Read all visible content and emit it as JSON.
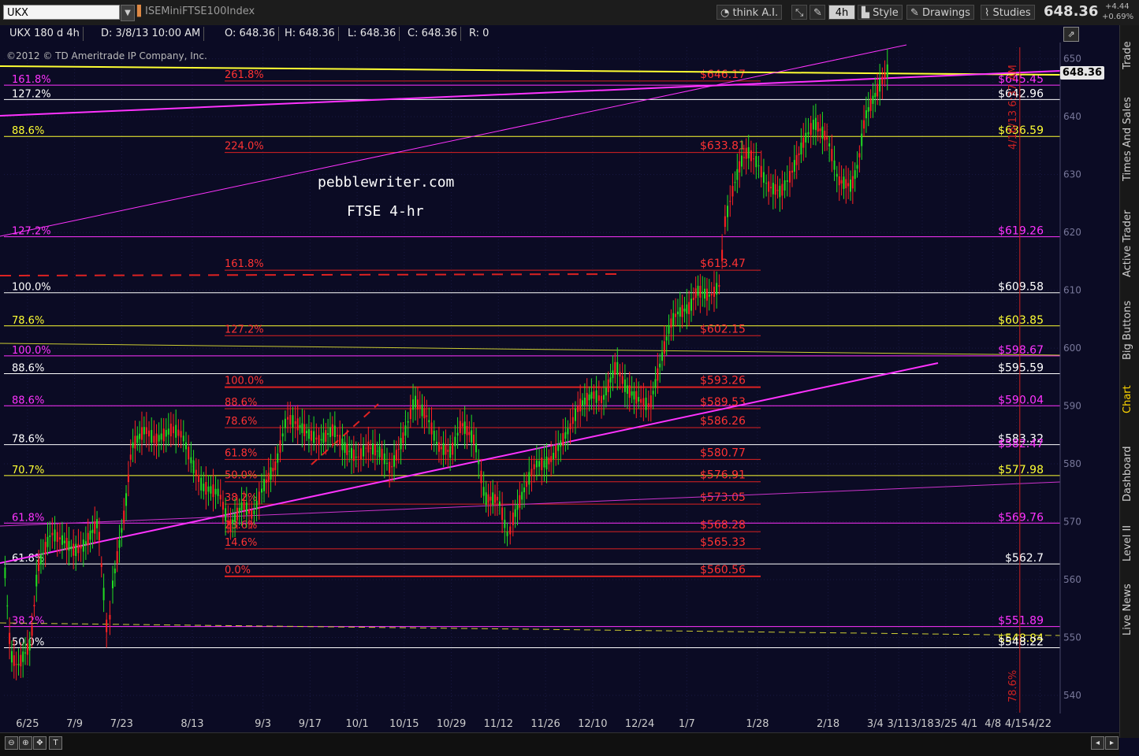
{
  "toolbar": {
    "symbol": "UKX",
    "symbol_description": "ISEMiniFTSE100Index",
    "think_label": "think A.I.",
    "timeframe": "4h",
    "style_label": "Style",
    "drawings_label": "Drawings",
    "studies_label": "Studies",
    "last_price": "648.36",
    "change_abs": "+4.44",
    "change_pct": "+0.69%"
  },
  "infobar": {
    "study": "UKX 180 d 4h",
    "date": "D: 3/8/13 10:00 AM",
    "open": "O: 648.36",
    "high": "H: 648.36",
    "low": "L: 648.36",
    "close": "C: 648.36",
    "range": "R: 0"
  },
  "copyright": "©2012 © TD Ameritrade IP Company, Inc.",
  "side_tabs": [
    "Trade",
    "Times And Sales",
    "Active Trader",
    "Big Buttons",
    "Chart",
    "Dashboard",
    "Level II",
    "Live News"
  ],
  "price_tag": "648.36",
  "colors": {
    "background": "#0b0b24",
    "magenta": "#ff33ff",
    "yellow": "#ffff33",
    "white": "#ffffff",
    "red": "#ff2222",
    "candle_up": "#22dd22",
    "candle_down": "#ff2222"
  },
  "chart_data": {
    "type": "line",
    "title": "FTSE 4-hr",
    "watermark": "pebblewriter.com",
    "x_ticks": [
      "6/25",
      "7/9",
      "7/23",
      "8/13",
      "9/3",
      "9/17",
      "10/1",
      "10/15",
      "10/29",
      "11/12",
      "11/26",
      "12/10",
      "12/24",
      "1/7",
      "1/28",
      "2/18",
      "3/4",
      "3/11",
      "3/18",
      "3/25",
      "4/1",
      "4/8",
      "4/15",
      "4/22"
    ],
    "y_ticks": [
      540,
      550,
      560,
      570,
      580,
      590,
      600,
      610,
      620,
      630,
      640,
      650
    ],
    "ylim": [
      537,
      652
    ],
    "x_range": [
      "2012-06-18",
      "2013-04-28"
    ],
    "series": [
      {
        "values": [
          [
            "2012-06-18",
            564
          ],
          [
            "2012-06-20",
            547
          ],
          [
            "2012-06-22",
            545
          ],
          [
            "2012-06-26",
            549
          ],
          [
            "2012-06-28",
            562
          ],
          [
            "2012-07-02",
            568
          ],
          [
            "2012-07-05",
            567
          ],
          [
            "2012-07-09",
            565
          ],
          [
            "2012-07-12",
            566
          ],
          [
            "2012-07-16",
            570
          ],
          [
            "2012-07-18",
            555
          ],
          [
            "2012-07-19",
            549
          ],
          [
            "2012-07-20",
            558
          ],
          [
            "2012-07-24",
            572
          ],
          [
            "2012-07-26",
            583
          ],
          [
            "2012-07-30",
            586
          ],
          [
            "2012-08-02",
            584
          ],
          [
            "2012-08-07",
            586
          ],
          [
            "2012-08-10",
            585
          ],
          [
            "2012-08-13",
            580
          ],
          [
            "2012-08-16",
            576
          ],
          [
            "2012-08-21",
            575
          ],
          [
            "2012-08-24",
            569
          ],
          [
            "2012-08-28",
            573
          ],
          [
            "2012-08-31",
            571
          ],
          [
            "2012-09-03",
            576
          ],
          [
            "2012-09-07",
            580
          ],
          [
            "2012-09-10",
            588
          ],
          [
            "2012-09-13",
            587
          ],
          [
            "2012-09-17",
            585
          ],
          [
            "2012-09-20",
            584
          ],
          [
            "2012-09-24",
            586
          ],
          [
            "2012-09-27",
            583
          ],
          [
            "2012-10-01",
            581
          ],
          [
            "2012-10-04",
            583
          ],
          [
            "2012-10-08",
            582
          ],
          [
            "2012-10-11",
            579
          ],
          [
            "2012-10-15",
            585
          ],
          [
            "2012-10-18",
            591
          ],
          [
            "2012-10-22",
            588
          ],
          [
            "2012-10-25",
            583
          ],
          [
            "2012-10-29",
            582
          ],
          [
            "2012-11-01",
            587
          ],
          [
            "2012-11-05",
            584
          ],
          [
            "2012-11-08",
            574
          ],
          [
            "2012-11-12",
            574
          ],
          [
            "2012-11-15",
            567
          ],
          [
            "2012-11-16",
            570
          ],
          [
            "2012-11-20",
            576
          ],
          [
            "2012-11-23",
            580
          ],
          [
            "2012-11-26",
            580
          ],
          [
            "2012-11-28",
            581
          ],
          [
            "2012-12-03",
            586
          ],
          [
            "2012-12-06",
            590
          ],
          [
            "2012-12-10",
            592
          ],
          [
            "2012-12-13",
            591
          ],
          [
            "2012-12-17",
            597
          ],
          [
            "2012-12-20",
            593
          ],
          [
            "2012-12-24",
            591
          ],
          [
            "2012-12-27",
            590
          ],
          [
            "2013-01-02",
            604
          ],
          [
            "2013-01-04",
            606
          ],
          [
            "2013-01-08",
            607
          ],
          [
            "2013-01-10",
            610
          ],
          [
            "2013-01-14",
            609
          ],
          [
            "2013-01-17",
            611
          ],
          [
            "2013-01-18",
            621
          ],
          [
            "2013-01-21",
            628
          ],
          [
            "2013-01-23",
            632
          ],
          [
            "2013-01-25",
            634
          ],
          [
            "2013-01-28",
            632
          ],
          [
            "2013-01-31",
            628
          ],
          [
            "2013-02-04",
            627
          ],
          [
            "2013-02-07",
            630
          ],
          [
            "2013-02-11",
            636
          ],
          [
            "2013-02-14",
            639
          ],
          [
            "2013-02-18",
            636
          ],
          [
            "2013-02-21",
            629
          ],
          [
            "2013-02-25",
            628
          ],
          [
            "2013-02-27",
            632
          ],
          [
            "2013-03-01",
            640
          ],
          [
            "2013-03-05",
            645
          ],
          [
            "2013-03-08",
            648.36
          ]
        ]
      }
    ],
    "levels_left": [
      {
        "label": "161.8%",
        "price": 645.45,
        "color": "#ff33ff"
      },
      {
        "label": "127.2%",
        "price": 642.96,
        "color": "#ffffff"
      },
      {
        "label": "88.6%",
        "price": 636.59,
        "color": "#ffff33"
      },
      {
        "label": "127.2%",
        "price": 619.26,
        "color": "#ff33ff"
      },
      {
        "label": "100.0%",
        "price": 609.58,
        "color": "#ffffff"
      },
      {
        "label": "78.6%",
        "price": 603.85,
        "color": "#ffff33"
      },
      {
        "label": "100.0%",
        "price": 598.67,
        "color": "#ff33ff"
      },
      {
        "label": "88.6%",
        "price": 595.59,
        "color": "#ffffff"
      },
      {
        "label": "88.6%",
        "price": 590.04,
        "color": "#ff33ff"
      },
      {
        "label": "78.6%",
        "price": 583.32,
        "color": "#ffffff"
      },
      {
        "label": "70.7%",
        "price": 577.98,
        "color": "#ffff33"
      },
      {
        "label": "61.8%",
        "price": 569.76,
        "color": "#ff33ff"
      },
      {
        "label": "61.8%",
        "price": 562.7,
        "color": "#ffffff"
      },
      {
        "label": "38.2%",
        "price": 551.89,
        "color": "#ff33ff"
      },
      {
        "label": "50.0%",
        "price": 548.22,
        "color": "#ffffff"
      }
    ],
    "levels_right": [
      {
        "label": "$645.45",
        "price": 645.45,
        "color": "#ff33ff"
      },
      {
        "label": "$642.96",
        "price": 642.96,
        "color": "#ffffff"
      },
      {
        "label": "$636.59",
        "price": 636.59,
        "color": "#ffff33"
      },
      {
        "label": "$619.26",
        "price": 619.26,
        "color": "#ff33ff"
      },
      {
        "label": "$609.58",
        "price": 609.58,
        "color": "#ffffff"
      },
      {
        "label": "$603.85",
        "price": 603.85,
        "color": "#ffff33"
      },
      {
        "label": "$598.67",
        "price": 598.67,
        "color": "#ff33ff"
      },
      {
        "label": "$595.59",
        "price": 595.59,
        "color": "#ffffff"
      },
      {
        "label": "$590.04",
        "price": 590.04,
        "color": "#ff33ff"
      },
      {
        "label": "$583.32",
        "price": 583.32,
        "color": "#ffffff"
      },
      {
        "label": "$582.47",
        "price": 582.47,
        "color": "#ff33ff"
      },
      {
        "label": "$577.98",
        "price": 577.98,
        "color": "#ffff33"
      },
      {
        "label": "$569.76",
        "price": 569.76,
        "color": "#ff33ff"
      },
      {
        "label": "$562.7",
        "price": 562.7,
        "color": "#ffffff"
      },
      {
        "label": "$551.89",
        "price": 551.89,
        "color": "#ff33ff"
      },
      {
        "label": "$548.84",
        "price": 548.84,
        "color": "#ffff33"
      },
      {
        "label": "$548.22",
        "price": 548.22,
        "color": "#ffffff"
      }
    ],
    "fib_red": [
      {
        "pct": "261.8%",
        "value": "$646.17",
        "price": 646.17
      },
      {
        "pct": "224.0%",
        "value": "$633.81",
        "price": 633.81
      },
      {
        "pct": "161.8%",
        "value": "$613.47",
        "price": 613.47
      },
      {
        "pct": "127.2%",
        "value": "$602.15",
        "price": 602.15
      },
      {
        "pct": "100.0%",
        "value": "$593.26",
        "price": 593.26
      },
      {
        "pct": "88.6%",
        "value": "$589.53",
        "price": 589.53
      },
      {
        "pct": "78.6%",
        "value": "$586.26",
        "price": 586.26
      },
      {
        "pct": "61.8%",
        "value": "$580.77",
        "price": 580.77
      },
      {
        "pct": "50.0%",
        "value": "$576.91",
        "price": 576.91
      },
      {
        "pct": "38.2%",
        "value": "$573.05",
        "price": 573.05
      },
      {
        "pct": "23.6%",
        "value": "$568.28",
        "price": 568.28
      },
      {
        "pct": "14.6%",
        "value": "$565.33",
        "price": 565.33
      },
      {
        "pct": "0.0%",
        "value": "$560.56",
        "price": 560.56
      }
    ],
    "vertical_marker": {
      "date": "2013-04-16",
      "label": "4/16/13 6:37 AM",
      "bottom_label": "78.6%"
    }
  }
}
